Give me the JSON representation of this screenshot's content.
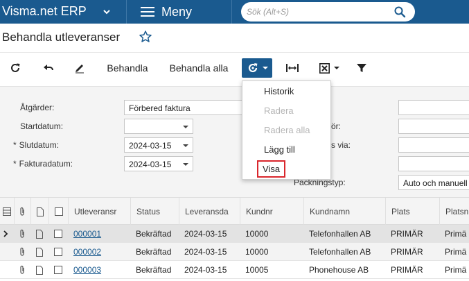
{
  "topbar": {
    "brand": "Visma.net ERP",
    "menu_label": "Meny",
    "search_placeholder": "Sök (Alt+S)"
  },
  "page": {
    "title": "Behandla utleveranser"
  },
  "toolbar": {
    "process_label": "Behandla",
    "process_all_label": "Behandla alla"
  },
  "actions_menu": {
    "items": [
      {
        "label": "Historik",
        "enabled": true
      },
      {
        "label": "Radera",
        "enabled": false
      },
      {
        "label": "Radera alla",
        "enabled": false
      },
      {
        "label": "Lägg till",
        "enabled": true
      },
      {
        "label": "Visa",
        "enabled": true
      }
    ]
  },
  "form": {
    "action_label": "Åtgärder:",
    "action_value": "Förbered faktura",
    "start_date_label": "Startdatum:",
    "start_date_value": "",
    "end_date_label": "Slutdatum:",
    "end_date_value": "2024-03-15",
    "invoice_date_label": "Fakturadatum:",
    "invoice_date_value": "2024-03-15",
    "partial_label_2": "ör:",
    "partial_label_3": "s via:",
    "packing_type_label": "Packningstyp:",
    "packing_type_value": "Auto och manuell",
    "required_mark": "*"
  },
  "grid": {
    "columns": [
      "Utleveransr",
      "Status",
      "Leveransda",
      "Kundnr",
      "Kundnamn",
      "Plats",
      "Platsn"
    ],
    "rows": [
      {
        "shipment": "000001",
        "status": "Bekräftad",
        "date": "2024-03-15",
        "customer_no": "10000",
        "customer_name": "Telefonhallen AB",
        "location": "PRIMÄR",
        "location_name": "Primä"
      },
      {
        "shipment": "000002",
        "status": "Bekräftad",
        "date": "2024-03-15",
        "customer_no": "10000",
        "customer_name": "Telefonhallen AB",
        "location": "PRIMÄR",
        "location_name": "Primä"
      },
      {
        "shipment": "000003",
        "status": "Bekräftad",
        "date": "2024-03-15",
        "customer_no": "10005",
        "customer_name": "Phonehouse AB",
        "location": "PRIMÄR",
        "location_name": "Primä"
      }
    ]
  },
  "colors": {
    "brand_blue": "#1a5a8f",
    "highlight_red": "#d9262c"
  }
}
